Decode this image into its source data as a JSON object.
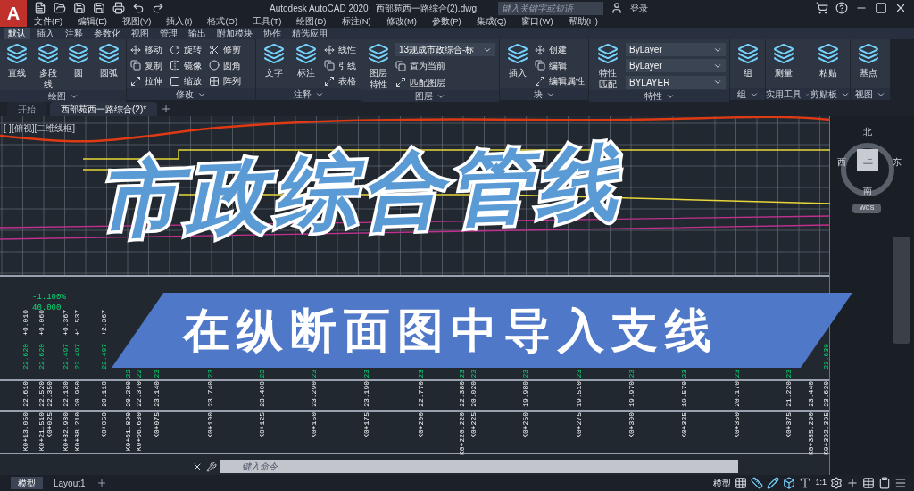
{
  "app_menu": {
    "label": "A"
  },
  "title": {
    "product": "Autodesk AutoCAD 2020",
    "file": "西部苑西一路综合(2).dwg"
  },
  "search": {
    "placeholder": "键入关键字或短语"
  },
  "account": {
    "label": "登录"
  },
  "menus": [
    "文件(F)",
    "编辑(E)",
    "视图(V)",
    "插入(I)",
    "格式(O)",
    "工具(T)",
    "绘图(D)",
    "标注(N)",
    "修改(M)",
    "参数(P)",
    "集成(Q)",
    "窗口(W)",
    "帮助(H)"
  ],
  "ribbon_tabs": [
    {
      "label": "默认",
      "selected": true
    },
    {
      "label": "插入",
      "selected": false
    },
    {
      "label": "注释",
      "selected": false
    },
    {
      "label": "参数化",
      "selected": false
    },
    {
      "label": "视图",
      "selected": false
    },
    {
      "label": "管理",
      "selected": false
    },
    {
      "label": "输出",
      "selected": false
    },
    {
      "label": "附加模块",
      "selected": false
    },
    {
      "label": "协作",
      "selected": false
    },
    {
      "label": "精选应用",
      "selected": false
    }
  ],
  "panels": [
    {
      "title": "绘图",
      "tools": [
        {
          "kind": "large",
          "label": "直线"
        },
        {
          "kind": "large",
          "label": "多段线"
        },
        {
          "kind": "large",
          "label": "圆"
        },
        {
          "kind": "large",
          "label": "圆弧"
        }
      ]
    },
    {
      "title": "修改",
      "tools": [
        {
          "kind": "small",
          "label": "移动"
        },
        {
          "kind": "small",
          "label": "复制"
        },
        {
          "kind": "small",
          "label": "拉伸"
        },
        {
          "kind": "small",
          "label": "旋转"
        },
        {
          "kind": "small",
          "label": "镜像"
        },
        {
          "kind": "small",
          "label": "缩放"
        },
        {
          "kind": "small",
          "label": "修剪"
        },
        {
          "kind": "small",
          "label": "圆角"
        },
        {
          "kind": "small",
          "label": "阵列"
        }
      ]
    },
    {
      "title": "注释",
      "tools": [
        {
          "kind": "large",
          "label": "文字"
        },
        {
          "kind": "large",
          "label": "标注"
        },
        {
          "kind": "small",
          "label": "线性"
        },
        {
          "kind": "small",
          "label": "引线"
        },
        {
          "kind": "small",
          "label": "表格"
        }
      ]
    },
    {
      "title": "图层",
      "tools": [
        {
          "kind": "large",
          "label": "图层特性"
        },
        {
          "kind": "dropdown",
          "label": "13规成市政综合-标"
        },
        {
          "kind": "small",
          "label": "置为当前"
        },
        {
          "kind": "small",
          "label": "匹配图层"
        }
      ]
    },
    {
      "title": "块",
      "tools": [
        {
          "kind": "large",
          "label": "插入"
        },
        {
          "kind": "small",
          "label": "创建"
        },
        {
          "kind": "small",
          "label": "编辑"
        },
        {
          "kind": "small",
          "label": "编辑属性"
        }
      ]
    },
    {
      "title": "特性",
      "tools": [
        {
          "kind": "large",
          "label": "特性匹配"
        },
        {
          "kind": "dropdown",
          "label": "ByLayer"
        },
        {
          "kind": "dropdown",
          "label": "ByLayer"
        },
        {
          "kind": "dropdown",
          "label": "BYLAYER"
        }
      ]
    },
    {
      "title": "组",
      "tools": [
        {
          "kind": "large",
          "label": "组"
        }
      ]
    },
    {
      "title": "实用工具",
      "tools": [
        {
          "kind": "large",
          "label": "测量"
        }
      ]
    },
    {
      "title": "剪贴板",
      "tools": [
        {
          "kind": "large",
          "label": "粘贴"
        }
      ]
    },
    {
      "title": "视图",
      "tools": [
        {
          "kind": "large",
          "label": "基点"
        }
      ]
    }
  ],
  "doc_tabs": [
    {
      "label": "开始",
      "selected": false
    },
    {
      "label": "西部苑西一路综合(2)*",
      "selected": true
    }
  ],
  "viewport": {
    "label": "[-][俯视][二维线框]"
  },
  "viewcube": {
    "north": "北",
    "west": "西",
    "top": "上",
    "east": "东",
    "south": "南",
    "ucs": "WCS"
  },
  "overlay": {
    "title": "市政综合管线",
    "subtitle": "在纵断面图中导入支线"
  },
  "grade": {
    "slope": "-1.100%",
    "length": "40.000"
  },
  "profile_columns": [
    {
      "offset": "+0.010",
      "existing": "22.620",
      "design": "22.610",
      "station": "K0+13.050"
    },
    {
      "offset": "+0.060",
      "existing": "22.620",
      "design": "22.520",
      "station": "K0+21.510"
    },
    {
      "design": "22.350",
      "station": "K0+025"
    },
    {
      "offset": "+0.367",
      "existing": "22.497",
      "design": "22.130",
      "station": "K0+32.980"
    },
    {
      "offset": "+1.537",
      "existing": "22.497",
      "design": "20.950",
      "station": "K0+38.210"
    },
    {
      "offset": "+2.367",
      "existing": "22.497",
      "design": "20.110",
      "station": "K0+050"
    },
    {
      "existing": "22",
      "design": "20.200",
      "station": "K0+61.890"
    },
    {
      "existing": "22",
      "design": "22.370",
      "station": "K0+66.630"
    },
    {
      "existing": "23",
      "design": "23.140",
      "station": "K0+075"
    },
    {
      "existing": "23",
      "design": "23.740",
      "station": "K0+100"
    },
    {
      "existing": "23",
      "design": "23.400",
      "station": "K0+125"
    },
    {
      "existing": "23",
      "design": "23.290",
      "station": "K0+150"
    },
    {
      "existing": "23",
      "design": "23.190",
      "station": "K0+175"
    },
    {
      "existing": "23",
      "design": "22.770",
      "station": "K0+200"
    },
    {
      "existing": "23",
      "design": "22.380",
      "station": "K0+220.220"
    },
    {
      "existing": "23",
      "design": "20.020",
      "station": "K0+225"
    },
    {
      "existing": "23",
      "design": "19.980",
      "station": "K0+250"
    },
    {
      "existing": "23",
      "design": "19.510",
      "station": "K0+275"
    },
    {
      "existing": "23",
      "design": "19.970",
      "station": "K0+300"
    },
    {
      "existing": "23",
      "design": "19.570",
      "station": "K0+325"
    },
    {
      "existing": "23",
      "design": "20.170",
      "station": "K0+350"
    },
    {
      "existing": "23",
      "design": "21.220",
      "station": "K0+375"
    },
    {
      "design": "23.440",
      "station": "K0+385.290"
    },
    {
      "existing": "23.630",
      "design": "23.630",
      "station": "K0+392.395"
    }
  ],
  "command": {
    "placeholder": "键入命令"
  },
  "layout_tabs": [
    {
      "label": "模型",
      "selected": true
    },
    {
      "label": "Layout1",
      "selected": false
    }
  ],
  "status_bar": {
    "model": "模型",
    "scale": "1:1"
  }
}
